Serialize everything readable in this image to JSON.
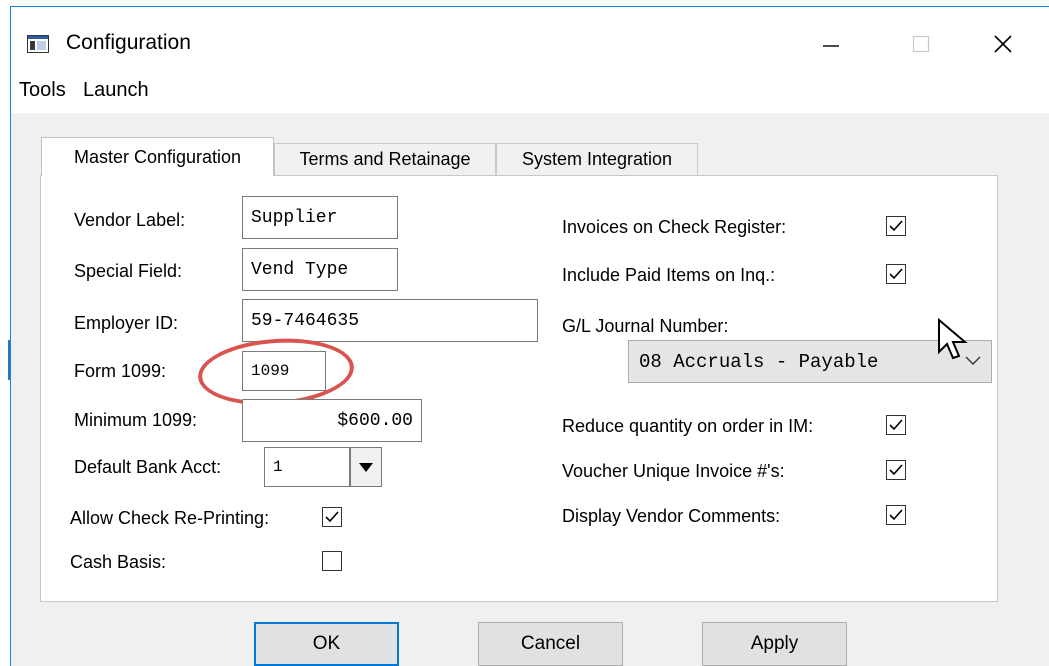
{
  "window": {
    "title": "Configuration"
  },
  "menu": [
    "Tools",
    "Launch"
  ],
  "tabs": [
    "Master Configuration",
    "Terms and Retainage",
    "System Integration"
  ],
  "left_fields": {
    "vendor_label": {
      "label": "Vendor Label:",
      "value": "Supplier"
    },
    "special_field": {
      "label": "Special Field:",
      "value": "Vend Type"
    },
    "employer_id": {
      "label": "Employer ID:",
      "value": "59-7464635"
    },
    "form_1099": {
      "label": "Form 1099:",
      "value": "1099"
    },
    "minimum_1099": {
      "label": "Minimum 1099:",
      "value": "$600.00"
    },
    "default_bank": {
      "label": "Default Bank Acct:",
      "value": "1"
    },
    "allow_reprint": {
      "label": "Allow Check Re-Printing:",
      "checked": true
    },
    "cash_basis": {
      "label": "Cash Basis:",
      "checked": false
    }
  },
  "right_fields": {
    "invoices_check_register": {
      "label": "Invoices on Check Register:",
      "checked": true
    },
    "include_paid_items": {
      "label": "Include Paid Items on Inq.:",
      "checked": true
    },
    "gl_journal": {
      "label": "G/L Journal Number:",
      "value": "08 Accruals - Payable"
    },
    "reduce_qty": {
      "label": "Reduce quantity on order in IM:",
      "checked": true
    },
    "voucher_unique": {
      "label": "Voucher Unique Invoice #'s:",
      "checked": true
    },
    "display_vendor_comments": {
      "label": "Display Vendor Comments:",
      "checked": true
    }
  },
  "buttons": {
    "ok": "OK",
    "cancel": "Cancel",
    "apply": "Apply"
  },
  "colors": {
    "highlight": "#d9534f",
    "window_border": "#1883d7",
    "default_button_border": "#0078d7"
  }
}
